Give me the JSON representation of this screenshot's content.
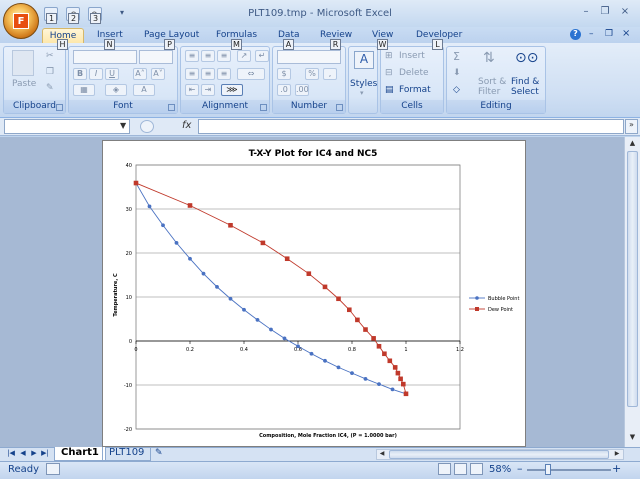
{
  "window": {
    "title": "PLT109.tmp - Microsoft Excel",
    "controls": {
      "minimize": "–",
      "restore": "❐",
      "close": "×"
    },
    "doc_controls": {
      "help": "?",
      "minimize": "–",
      "restore": "❐",
      "close": "×"
    }
  },
  "office_button": {
    "letter": "F"
  },
  "qat": {
    "keytips": [
      "1",
      "2",
      "3"
    ]
  },
  "ribbon": {
    "tabs": [
      {
        "label": "Home",
        "keytip": "H"
      },
      {
        "label": "Insert",
        "keytip": "N"
      },
      {
        "label": "Page Layout",
        "keytip": "P"
      },
      {
        "label": "Formulas",
        "keytip": "M"
      },
      {
        "label": "Data",
        "keytip": "A"
      },
      {
        "label": "Review",
        "keytip": "R"
      },
      {
        "label": "View",
        "keytip": "W"
      },
      {
        "label": "Developer",
        "keytip": "L"
      }
    ],
    "groups": {
      "clipboard": {
        "label": "Clipboard",
        "paste": "Paste"
      },
      "font": {
        "label": "Font",
        "bold": "B",
        "italic": "I",
        "underline": "U",
        "grow": "A˄",
        "shrink": "A˅",
        "color": "A"
      },
      "alignment": {
        "label": "Alignment"
      },
      "number": {
        "label": "Number",
        "currency": "$",
        "percent": "%",
        "comma": ","
      },
      "styles": {
        "label": "Styles"
      },
      "cells": {
        "label": "Cells",
        "insert": "Insert",
        "delete": "Delete",
        "format": "Format"
      },
      "editing": {
        "label": "Editing",
        "sum": "Σ",
        "sort_filter": "Sort & Filter",
        "sort_line1": "Sort &",
        "sort_line2": "Filter",
        "find_select": "Find & Select",
        "find_line1": "Find &",
        "find_line2": "Select"
      }
    }
  },
  "formula_bar": {
    "name_box": "",
    "fx": "fx",
    "formula": ""
  },
  "chart_data": {
    "type": "scatter",
    "title": "T-X-Y Plot for IC4 and NC5",
    "xlabel": "Composition, Mole Fraction IC4, (P = 1.0000 bar)",
    "ylabel": "Temperature, C",
    "xlim": [
      0,
      1.2
    ],
    "ylim": [
      -20,
      40
    ],
    "xticks": [
      "0",
      "0.2",
      "0.4",
      "0.6",
      "0.8",
      "1",
      "1.2"
    ],
    "yticks": [
      "40",
      "30",
      "20",
      "10",
      "0",
      "-10",
      "-20"
    ],
    "grid": "horizontal",
    "legend_position": "right",
    "series": [
      {
        "name": "Bubble Point",
        "color": "#4a72c2",
        "marker": "circle",
        "x": [
          0,
          0.05,
          0.1,
          0.15,
          0.2,
          0.25,
          0.3,
          0.35,
          0.4,
          0.45,
          0.5,
          0.55,
          0.6,
          0.65,
          0.7,
          0.75,
          0.8,
          0.85,
          0.9,
          0.95,
          1.0
        ],
        "y": [
          35.9,
          30.6,
          26.3,
          22.3,
          18.7,
          15.3,
          12.3,
          9.6,
          7.1,
          4.8,
          2.6,
          0.6,
          -1.2,
          -2.9,
          -4.5,
          -6.0,
          -7.3,
          -8.6,
          -9.8,
          -11.0,
          -12.0
        ]
      },
      {
        "name": "Dew Point",
        "color": "#c0392b",
        "marker": "square",
        "x": [
          0,
          0.2,
          0.35,
          0.47,
          0.56,
          0.64,
          0.7,
          0.75,
          0.79,
          0.82,
          0.85,
          0.88,
          0.9,
          0.92,
          0.94,
          0.96,
          0.97,
          0.98,
          0.99,
          1.0
        ],
        "y": [
          35.9,
          30.8,
          26.3,
          22.3,
          18.7,
          15.3,
          12.3,
          9.6,
          7.1,
          4.8,
          2.6,
          0.6,
          -1.2,
          -2.9,
          -4.5,
          -6.0,
          -7.3,
          -8.6,
          -9.8,
          -12.0
        ]
      }
    ]
  },
  "sheets": {
    "tabs": [
      "Chart1",
      "PLT109"
    ],
    "active": "Chart1"
  },
  "status": {
    "ready": "Ready",
    "zoom": "58%",
    "minus": "–",
    "plus": "+"
  }
}
